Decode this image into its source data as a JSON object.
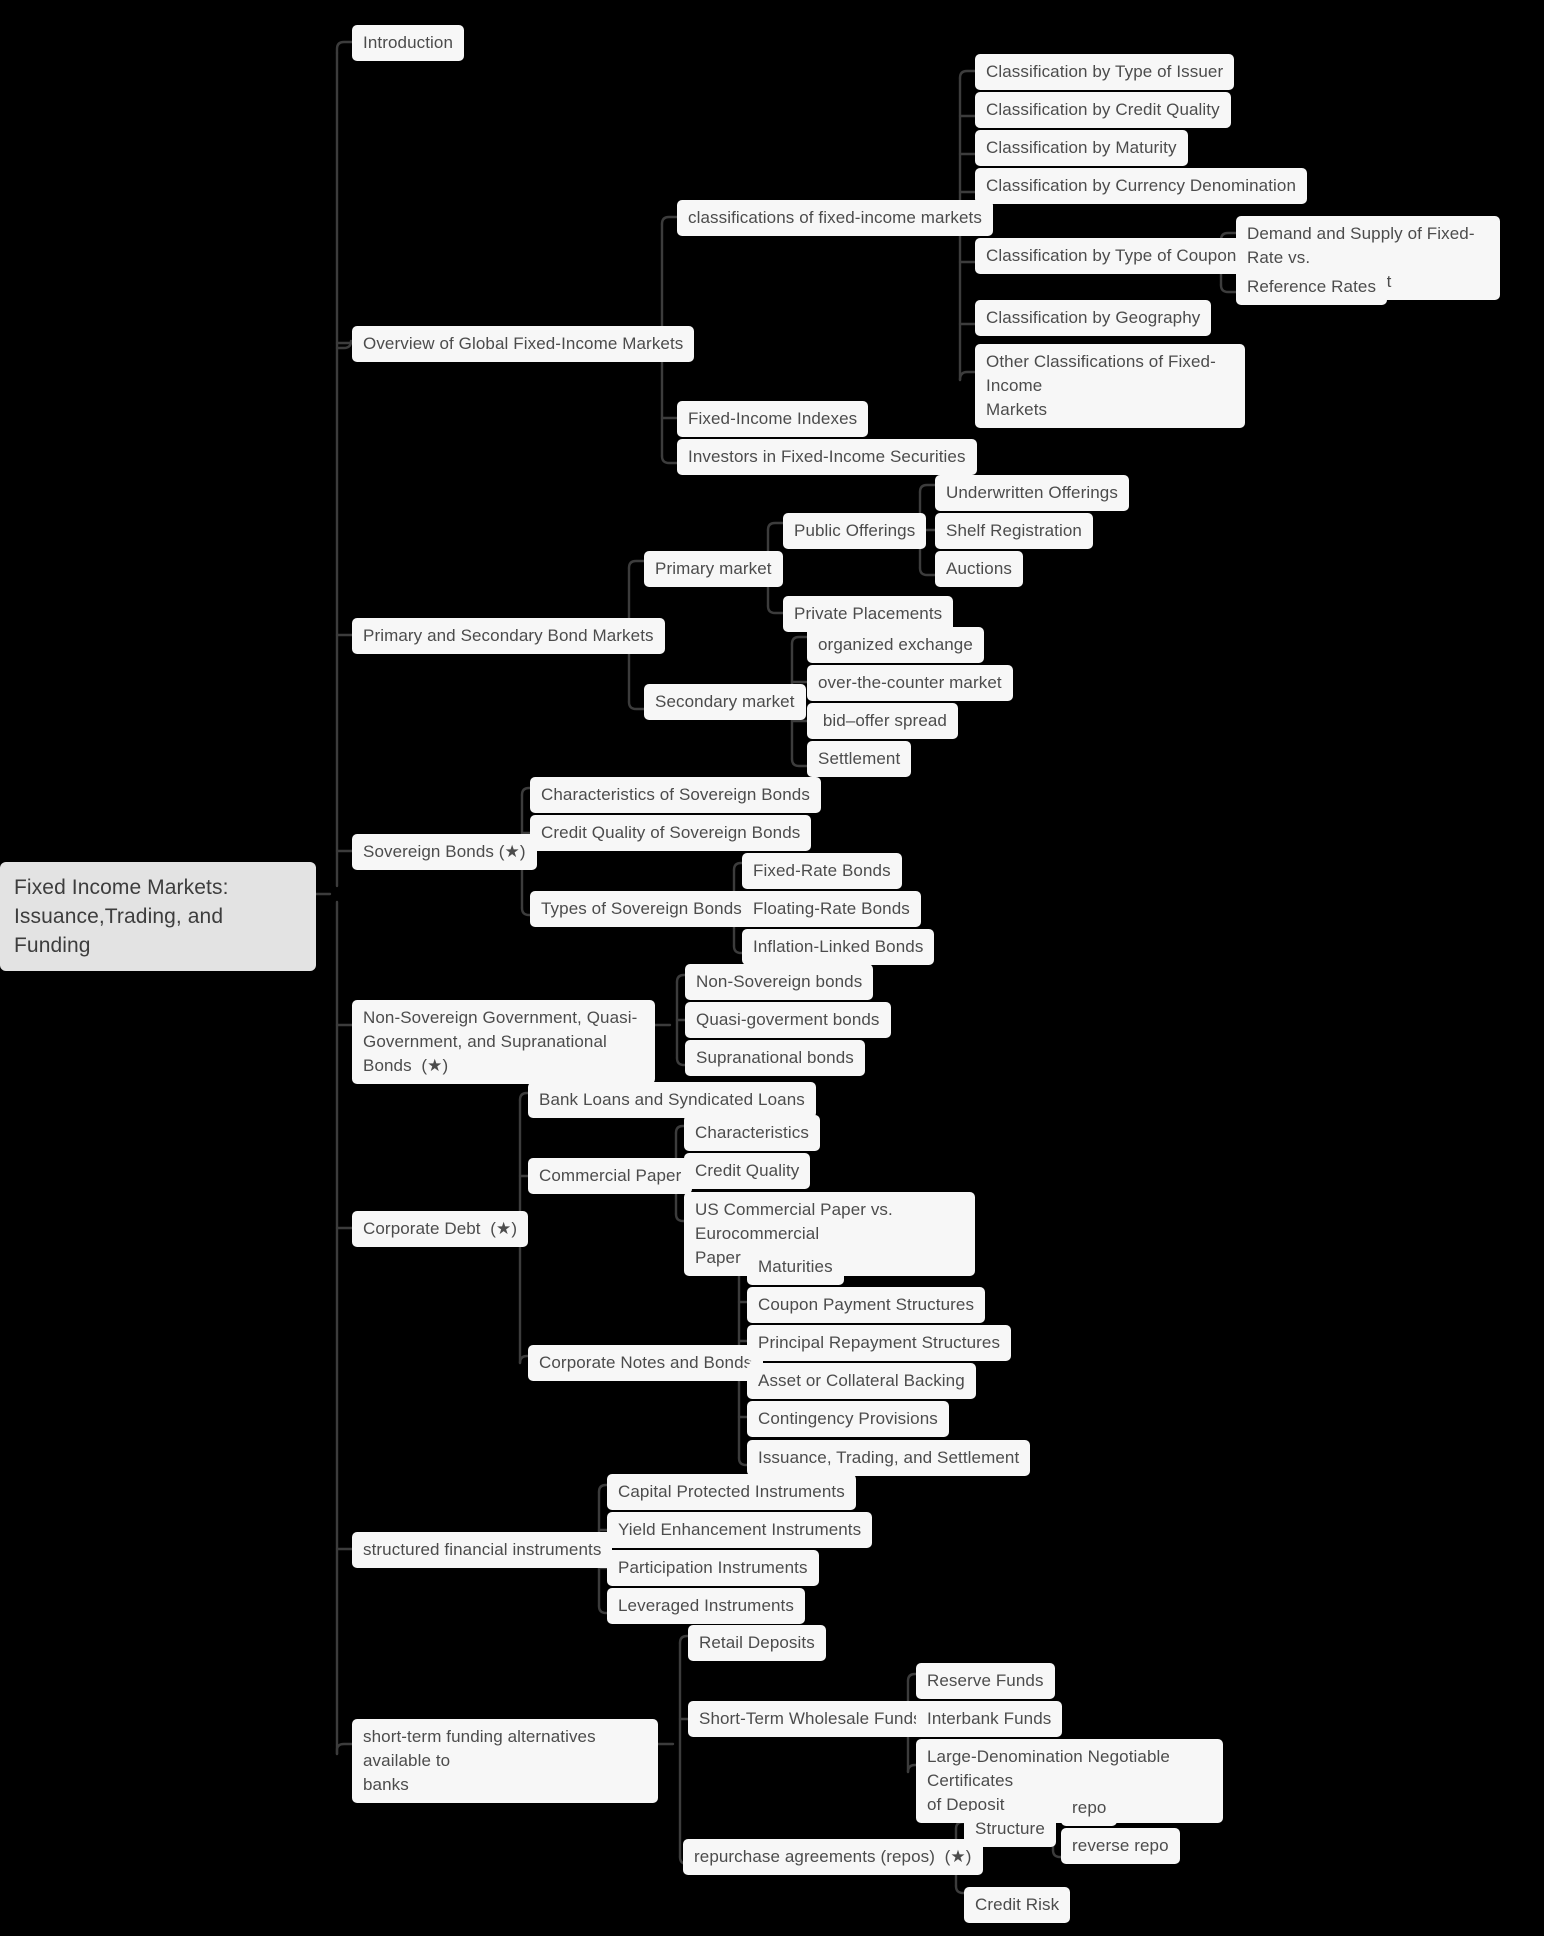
{
  "diagram": {
    "type": "mindmap",
    "title": "Fixed Income Markets: Issuance,Trading, and Funding",
    "orientation": "left-to-right",
    "colors": {
      "background": "#000000",
      "node_fill": "#f7f7f7",
      "node_text": "#4c4c4c",
      "root_fill": "#e3e3e3",
      "root_text": "#3d3d3d",
      "connector": "#3c3c3c"
    }
  },
  "nodes": {
    "root": "Fixed Income Markets:\nIssuance,Trading, and Funding",
    "n_introduction": "Introduction",
    "n_overview": "Overview of Global Fixed-Income Markets",
    "n_classifications": "classifications of fixed-income markets",
    "n_cls_issuer": "Classification by Type of Issuer",
    "n_cls_credit": "Classification by Credit Quality",
    "n_cls_maturity": "Classification by Maturity",
    "n_cls_currency": "Classification by Currency Denomination",
    "n_cls_coupon": "Classification by Type of Coupon",
    "n_demand_supply": "Demand and Supply of Fixed-Rate vs.\nFloating-Rate Debt",
    "n_reference_rates": "Reference Rates",
    "n_cls_geography": "Classification by Geography",
    "n_cls_other": "Other Classifications of Fixed-Income\nMarkets",
    "n_fi_indexes": "Fixed-Income Indexes",
    "n_fi_investors": "Investors in Fixed-Income Securities",
    "n_primsec": "Primary and Secondary Bond Markets",
    "n_primary_market": "Primary market",
    "n_public_offerings": "Public Offerings",
    "n_underwritten": "Underwritten Offerings",
    "n_shelf": "Shelf Registration",
    "n_auctions": "Auctions",
    "n_private_placements": "Private Placements",
    "n_secondary_market": "Secondary market",
    "n_organized_exchange": "organized exchange",
    "n_otc_market": "over-the-counter market",
    "n_bid_offer": " bid–offer spread",
    "n_settlement": "Settlement",
    "n_sovereign": "Sovereign Bonds (★)",
    "n_sov_char": "Characteristics of Sovereign Bonds",
    "n_sov_credit": "Credit Quality of Sovereign Bonds",
    "n_sov_types": "Types of Sovereign Bonds",
    "n_fixed_rate": "Fixed-Rate Bonds",
    "n_floating_rate": "Floating-Rate Bonds",
    "n_inflation_linked": "Inflation-Linked Bonds",
    "n_nonsov": "Non-Sovereign Government, Quasi-\nGovernment, and Supranational Bonds  (★)",
    "n_nonsov_bonds": "Non-Sovereign bonds",
    "n_quasi_bonds": "Quasi-goverment bonds",
    "n_supra_bonds": "Supranational bonds",
    "n_corporate_debt": "Corporate Debt  (★)",
    "n_bank_loans": "Bank Loans and Syndicated Loans",
    "n_commercial_paper": "Commercial Paper",
    "n_cp_char": "Characteristics",
    "n_cp_credit": "Credit Quality",
    "n_cp_us_vs_euro": "US Commercial Paper vs. Eurocommercial\nPaper",
    "n_corp_notes": "Corporate Notes and Bonds",
    "n_maturities": "Maturities",
    "n_coupon_payment": "Coupon Payment Structures",
    "n_principal_repay": "Principal Repayment Structures",
    "n_asset_backing": "Asset or Collateral Backing",
    "n_contingency": "Contingency Provisions",
    "n_issuance_trading": "Issuance, Trading, and Settlement",
    "n_structured": "structured financial instruments",
    "n_capital_protected": "Capital Protected Instruments",
    "n_yield_enhance": "Yield Enhancement Instruments",
    "n_participation": "Participation Instruments",
    "n_leveraged": "Leveraged Instruments",
    "n_shortterm": "short-term funding alternatives available to\nbanks",
    "n_retail_deposits": "Retail Deposits",
    "n_wholesale_funds": "Short-Term Wholesale Funds",
    "n_reserve_funds": "Reserve Funds",
    "n_interbank_funds": "Interbank Funds",
    "n_large_cd": "Large-Denomination Negotiable Certificates\nof Deposit",
    "n_repos": "repurchase agreements (repos)  (★)",
    "n_repo_structure": "Structure",
    "n_repo": "repo",
    "n_reverse_repo": "reverse repo",
    "n_repo_credit_risk": "Credit Risk"
  }
}
